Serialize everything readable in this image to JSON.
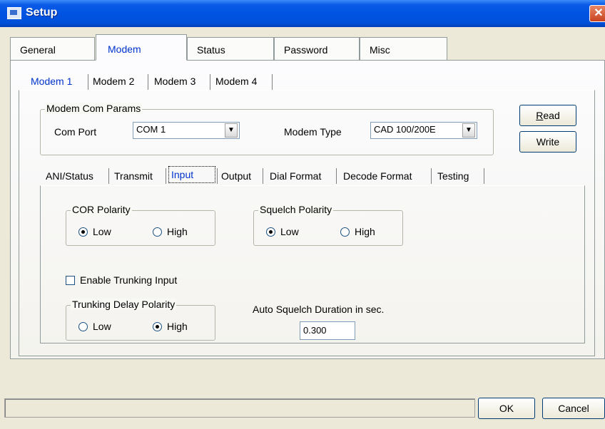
{
  "window": {
    "title": "Setup"
  },
  "outer_tabs": [
    "General",
    "Modem",
    "Status",
    "Password",
    "Misc"
  ],
  "modem_tabs": [
    "Modem 1",
    "Modem 2",
    "Modem 3",
    "Modem 4"
  ],
  "com_params": {
    "legend": "Modem Com Params",
    "com_port_label": "Com Port",
    "com_port_value": "COM 1",
    "modem_type_label": "Modem Type",
    "modem_type_value": "CAD 100/200E"
  },
  "buttons": {
    "read": "Read",
    "write": "Write",
    "ok": "OK",
    "cancel": "Cancel"
  },
  "inner_tabs": [
    "ANI/Status",
    "Transmit",
    "Input",
    "Output",
    "Dial Format",
    "Decode Format",
    "Testing"
  ],
  "input_tab": {
    "cor_polarity": {
      "legend": "COR Polarity",
      "low": "Low",
      "high": "High",
      "selected": "Low"
    },
    "squelch_polarity": {
      "legend": "Squelch Polarity",
      "low": "Low",
      "high": "High",
      "selected": "Low"
    },
    "enable_trunking_label": "Enable Trunking Input",
    "enable_trunking_checked": false,
    "trunking_delay": {
      "legend": "Trunking Delay Polarity",
      "low": "Low",
      "high": "High",
      "selected": "High"
    },
    "auto_squelch_label": "Auto Squelch Duration in sec.",
    "auto_squelch_value": "0.300"
  },
  "status_text": ""
}
